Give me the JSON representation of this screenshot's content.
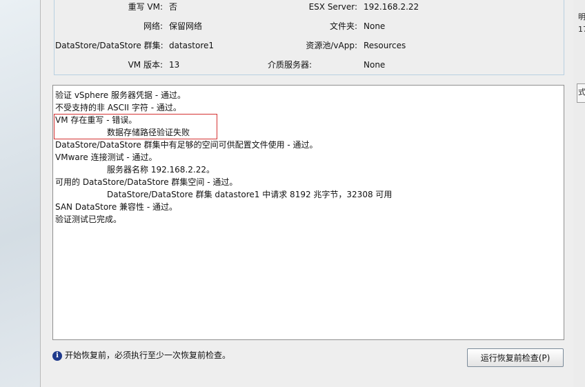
{
  "info": {
    "rows": [
      {
        "label1": "重写 VM:",
        "value1": "否",
        "label2": "ESX Server:",
        "value2": "192.168.2.22"
      },
      {
        "label1": "网络:",
        "value1": "保留网络",
        "label2": "文件夹:",
        "value2": "None"
      },
      {
        "label1": "DataStore/DataStore 群集:",
        "value1": "datastore1",
        "label2": "资源池/vApp:",
        "value2": "Resources"
      },
      {
        "label1": "VM 版本:",
        "value1": "13",
        "label2": "介质服务器:",
        "value2": "None"
      }
    ]
  },
  "log": {
    "lines": [
      "验证 vSphere 服务器凭据 - 通过。",
      "不受支持的非 ASCII 字符 - 通过。",
      "VM 存在重写 - 错误。",
      "数据存储路径验证失败",
      "DataStore/DataStore 群集中有足够的空间可供配置文件使用 - 通过。",
      "VMware 连接测试 - 通过。",
      "服务器名称 192.168.2.22。",
      "可用的 DataStore/DataStore 群集空间 - 通过。",
      "DataStore/DataStore 群集 datastore1 中请求 8192 兆字节，32308 可用",
      "SAN DataStore 兼容性 - 通过。",
      "验证测试已完成。"
    ]
  },
  "footer": {
    "info_text": "开始恢复前，必须执行至少一次恢复前检查。",
    "info_icon": "i",
    "run_button": "运行恢复前检查(P)"
  },
  "right_strip": {
    "t1": "明",
    "t2": "17",
    "t3": "式"
  },
  "colors": {
    "highlight": "#d43030",
    "info_icon": "#1f3a8c",
    "info_box_border": "#b8cfe0"
  }
}
